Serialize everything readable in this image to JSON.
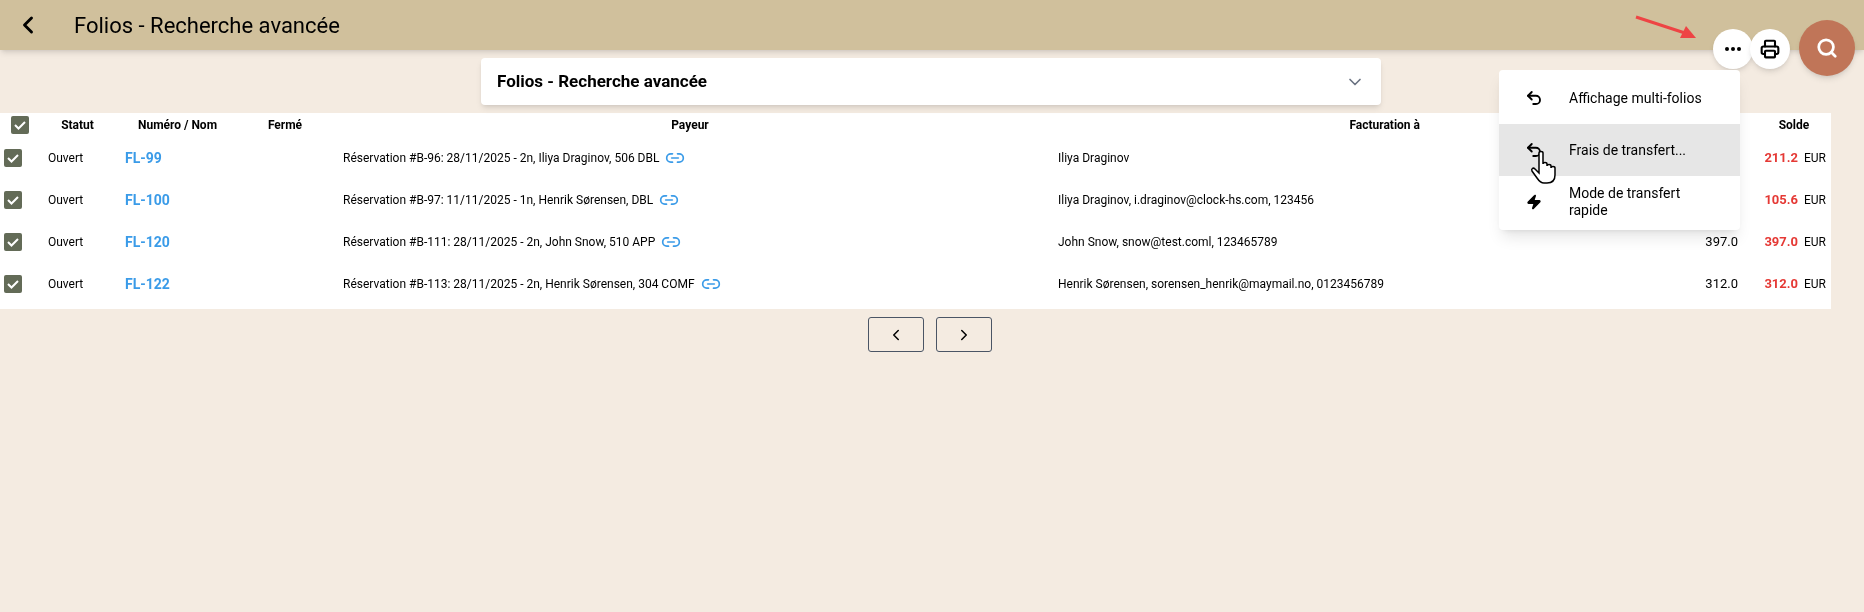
{
  "header": {
    "title": "Folios - Recherche avancée"
  },
  "search_panel": {
    "title": "Folios - Recherche avancée",
    "expanded": false
  },
  "table": {
    "all_checked": true,
    "columns": [
      "Statut",
      "Numéro / Nom",
      "Fermé",
      "Payeur",
      "Facturation à",
      "Solde"
    ],
    "rows": [
      {
        "checked": true,
        "status": "Ouvert",
        "number": "FL-99",
        "payer": "Réservation #B-96: 28/11/2025 - 2n, Iliya Draginov, 506 DBL",
        "billing": "Iliya Draginov",
        "solde": "211.2",
        "currency": "EUR"
      },
      {
        "checked": true,
        "status": "Ouvert",
        "number": "FL-100",
        "payer": "Réservation #B-97: 11/11/2025 - 1n, Henrik Sørensen, DBL",
        "billing": "Iliya Draginov, i.draginov@clock-hs.com, 123456",
        "solde": "105.6",
        "currency": "EUR"
      },
      {
        "checked": true,
        "status": "Ouvert",
        "number": "FL-120",
        "payer": "Réservation #B-111: 28/11/2025 - 2n, John Snow, 510 APP",
        "billing": "John Snow, snow@test.coml, 123465789",
        "amount": "397.0",
        "solde": "397.0",
        "currency": "EUR"
      },
      {
        "checked": true,
        "status": "Ouvert",
        "number": "FL-122",
        "payer": "Réservation #B-113: 28/11/2025 - 2n, Henrik Sørensen, 304 COMF",
        "billing": "Henrik Sørensen, sorensen_henrik@maymail.no, 0123456789",
        "amount": "312.0",
        "solde": "312.0",
        "currency": "EUR"
      }
    ]
  },
  "menu": {
    "items": [
      {
        "kind": "undo",
        "label": "Affichage multi-folios",
        "selected": false
      },
      {
        "kind": "undo",
        "label": "Frais de transfert...",
        "selected": true
      },
      {
        "kind": "bolt",
        "label": "Mode de transfert rapide",
        "selected": false
      }
    ]
  }
}
